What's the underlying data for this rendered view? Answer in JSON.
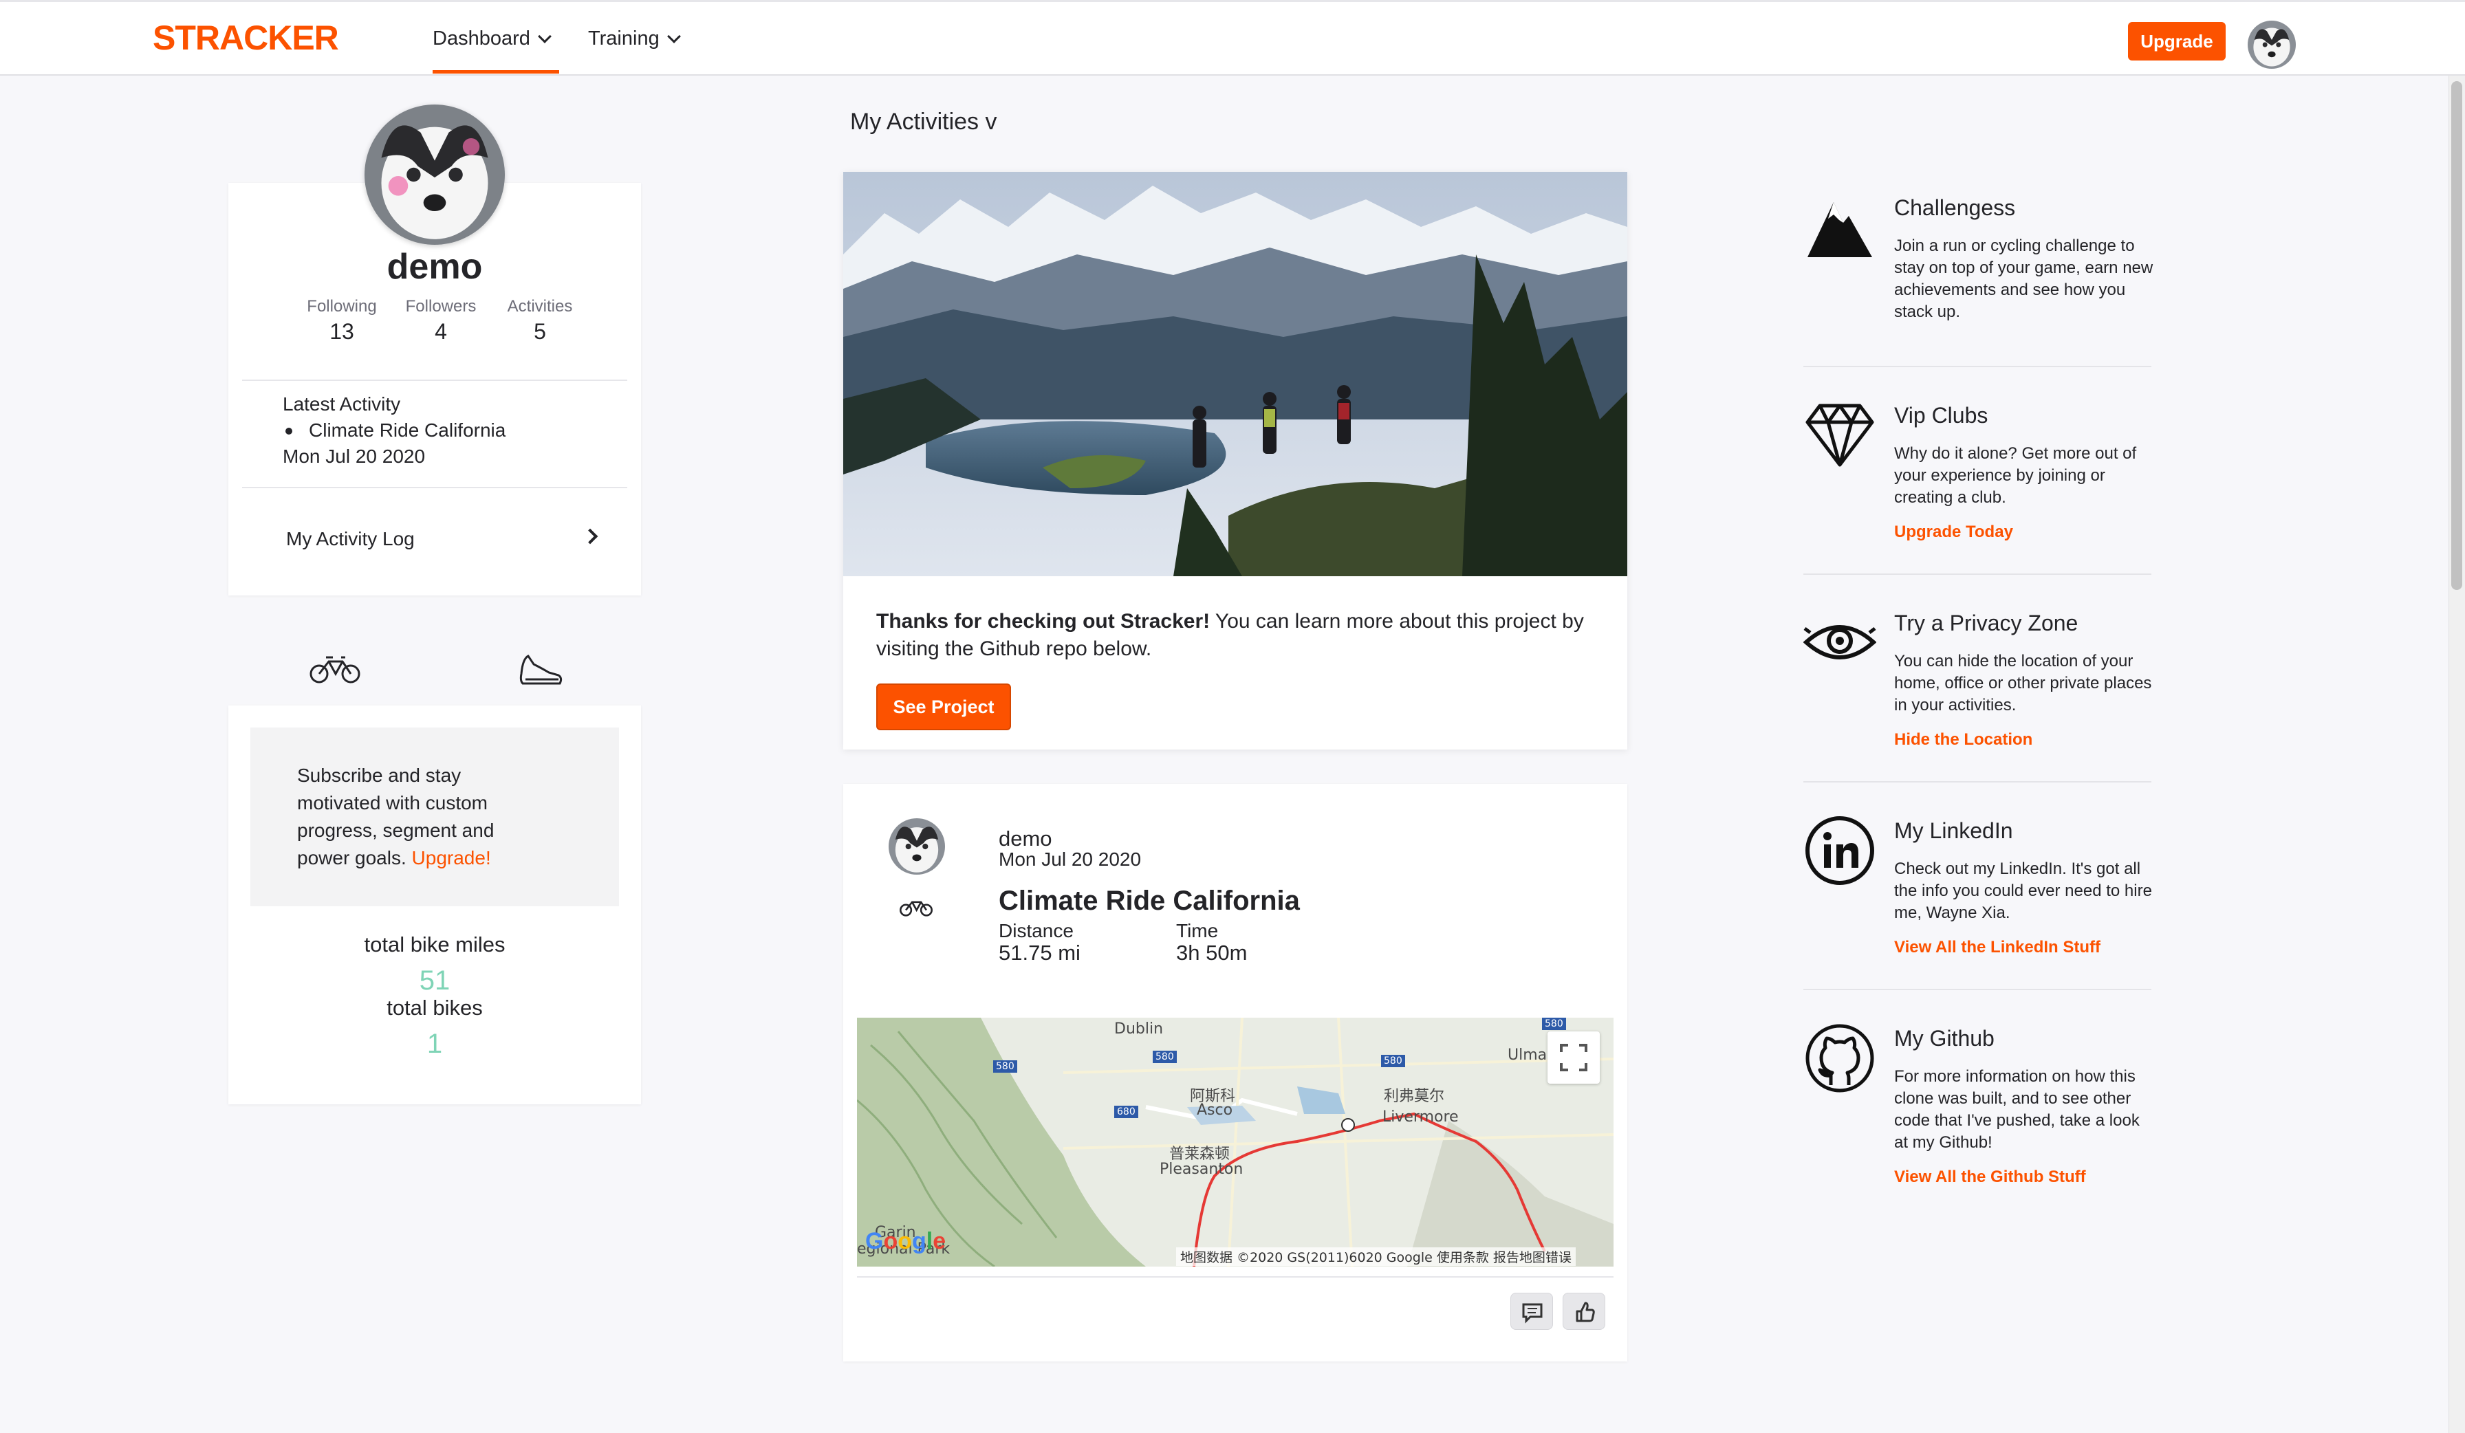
{
  "nav": {
    "logo": "STRACKER",
    "items": [
      {
        "label": "Dashboard"
      },
      {
        "label": "Training"
      }
    ],
    "upgrade_label": "Upgrade"
  },
  "profile": {
    "name": "demo",
    "stats": [
      {
        "label": "Following",
        "value": "13"
      },
      {
        "label": "Followers",
        "value": "4"
      },
      {
        "label": "Activities",
        "value": "5"
      }
    ],
    "latest_title": "Latest Activity",
    "latest_item": "Climate Ride California",
    "latest_date": "Mon Jul 20 2020",
    "activity_log_label": "My Activity Log"
  },
  "goals": {
    "text": "Subscribe and stay motivated with custom progress, segment and power goals.",
    "link": "Upgrade!",
    "metrics": [
      {
        "label": "total bike miles",
        "value": "51"
      },
      {
        "label": "total bikes",
        "value": "1"
      }
    ]
  },
  "feed": {
    "title": "My Activities v",
    "hero": {
      "bold": "Thanks for checking out Stracker!",
      "text": " You can learn more about this project by visiting the Github repo below.",
      "button": "See Project"
    },
    "activity": {
      "user": "demo",
      "date": "Mon Jul 20 2020",
      "title": "Climate Ride California",
      "distance_label": "Distance",
      "distance_value": "51.75 mi",
      "time_label": "Time",
      "time_value": "3h 50m",
      "map": {
        "labels": [
          "Dublin",
          "阿斯科",
          "Asco",
          "利弗莫尔",
          "Livermore",
          "普莱森顿",
          "Pleasanton",
          "Ulma",
          "Garin",
          "egional Park"
        ],
        "shields": [
          "580",
          "580",
          "680",
          "580",
          "580"
        ],
        "footer": "地图数据 ©2020 GS(2011)6020 Google   使用条款   报告地图错误",
        "google": [
          "G",
          "o",
          "o",
          "g",
          "l",
          "e"
        ]
      }
    }
  },
  "promos": [
    {
      "icon": "mountain-icon",
      "title": "Challengess",
      "desc": "Join a run or cycling challenge to stay on top of your game, earn new achievements and see how you stack up.",
      "link": ""
    },
    {
      "icon": "diamond-icon",
      "title": "Vip Clubs",
      "desc": "Why do it alone? Get more out of your experience by joining or creating a club.",
      "link": "Upgrade Today"
    },
    {
      "icon": "eye-icon",
      "title": "Try a Privacy Zone",
      "desc": "You can hide the location of your home, office or other private places in your activities.",
      "link": "Hide the Location"
    },
    {
      "icon": "linkedin-icon",
      "title": "My LinkedIn",
      "desc": "Check out my LinkedIn. It's got all the info you could ever need to hire me, Wayne Xia.",
      "link": "View All the LinkedIn Stuff"
    },
    {
      "icon": "github-icon",
      "title": "My Github",
      "desc": "For more information on how this clone was built, and to see other code that I've pushed, take a look at my Github!",
      "link": "View All the Github Stuff"
    }
  ],
  "colors": {
    "brand": "#fc5200",
    "metric": "#7fd4b6",
    "route": "#e53935"
  }
}
